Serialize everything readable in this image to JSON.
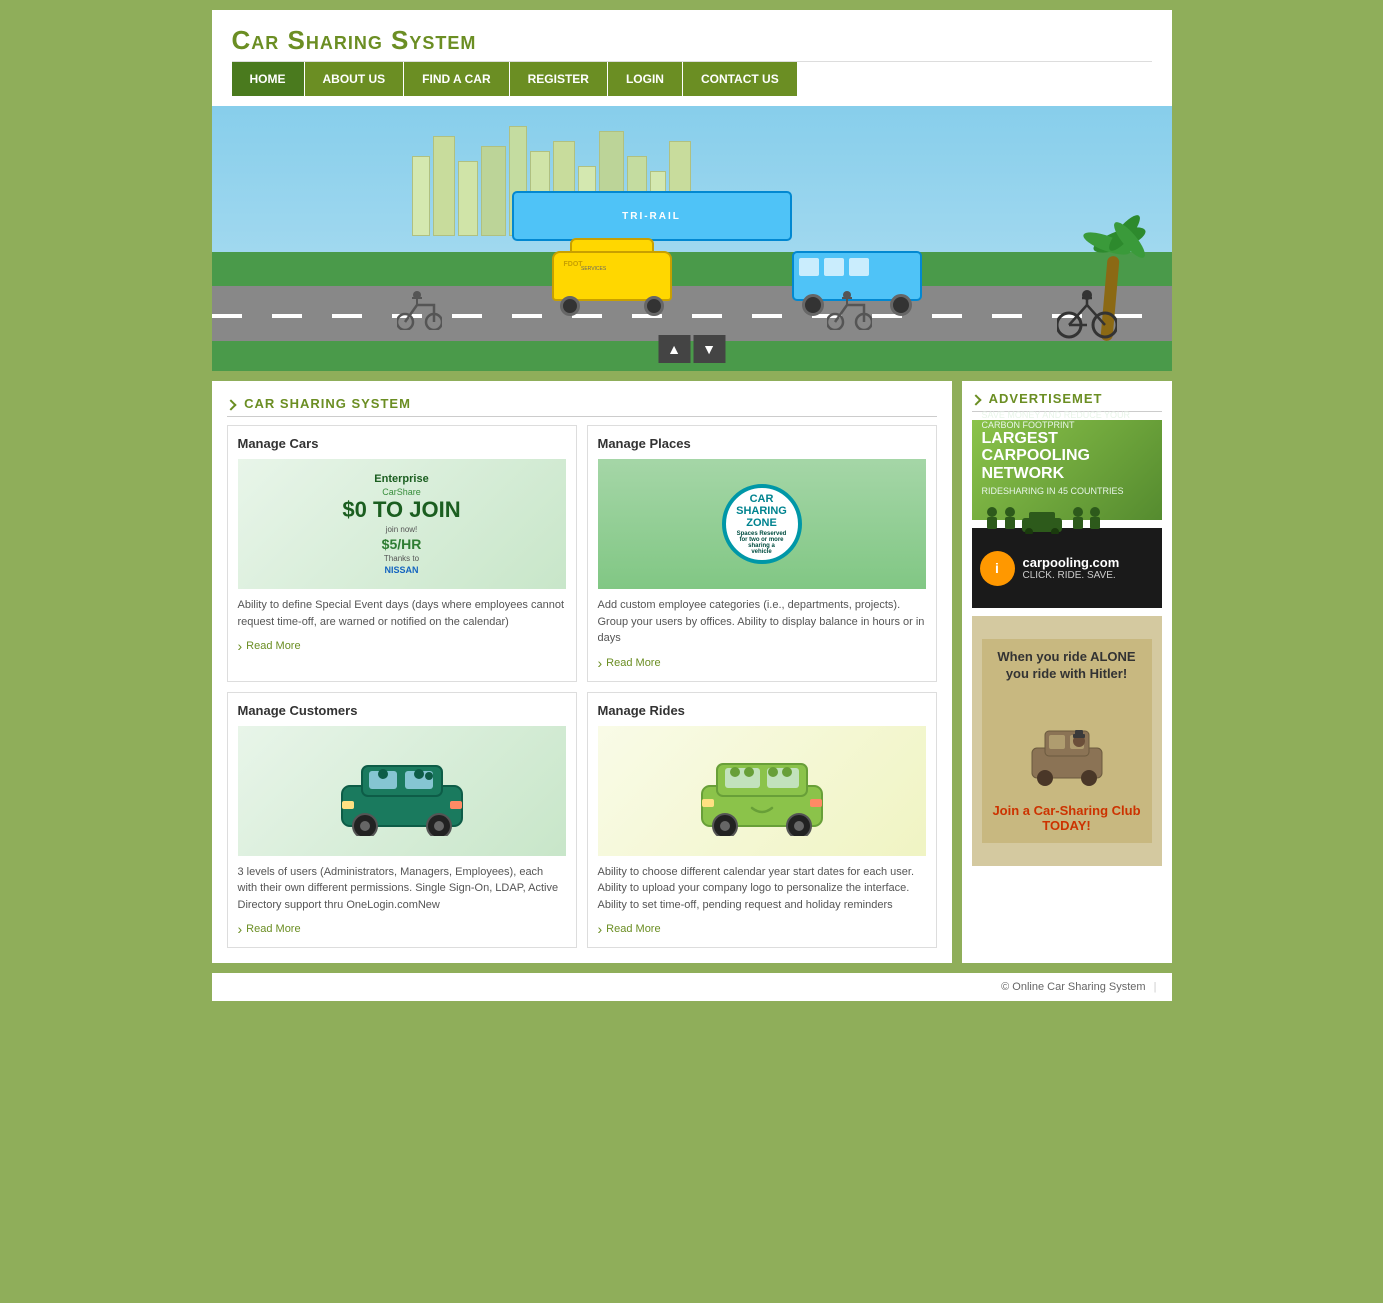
{
  "site": {
    "title": "Car Sharing System",
    "footer": "© Online Car Sharing System",
    "footer_divider": "|"
  },
  "nav": {
    "items": [
      {
        "id": "home",
        "label": "HOME",
        "active": true
      },
      {
        "id": "about",
        "label": "ABOUT US",
        "active": false
      },
      {
        "id": "find",
        "label": "FIND A CAR",
        "active": false
      },
      {
        "id": "register",
        "label": "REGISTER",
        "active": false
      },
      {
        "id": "login",
        "label": "LOGIN",
        "active": false
      },
      {
        "id": "contact",
        "label": "CONTACT US",
        "active": false
      }
    ]
  },
  "banner": {
    "up_label": "▲",
    "down_label": "▼"
  },
  "main_section": {
    "title": "CAR SHARING SYSTEM",
    "cards": [
      {
        "id": "manage-cars",
        "title": "Manage Cars",
        "image_alt": "Enterprise CarShare - $0 to Join, $5/HR Rates",
        "text": "Ability to define Special Event days (days where employees cannot request time-off, are warned or notified on the calendar)",
        "read_more": "Read More"
      },
      {
        "id": "manage-places",
        "title": "Manage Places",
        "image_alt": "Car Sharing Zone sign",
        "text": "Add custom employee categories (i.e., departments, projects). Group your users by offices. Ability to display balance in hours or in days",
        "read_more": "Read More"
      },
      {
        "id": "manage-customers",
        "title": "Manage Customers",
        "image_alt": "Car with people icon",
        "text": "3 levels of users (Administrators, Managers, Employees), each with their own different permissions. Single Sign-On, LDAP, Active Directory support thru OneLogin.comNew",
        "read_more": "Read More"
      },
      {
        "id": "manage-rides",
        "title": "Manage Rides",
        "image_alt": "Car with passengers icon",
        "text": "Ability to choose different calendar year start dates for each user. Ability to upload your company logo to personalize the interface. Ability to set time-off, pending request and holiday reminders",
        "read_more": "Read More"
      }
    ]
  },
  "sidebar": {
    "title": "ADVERTISEMET",
    "ads": [
      {
        "id": "carpooling-network",
        "headline": "LARGEST\nCARPOOLING\nNETWORK",
        "subtext": "SAVE MONEY AND REDUCE YOUR CARBON FOOTPRINT",
        "detail": "RIDESHARING IN 45 COUNTRIES"
      },
      {
        "id": "carpooling-com",
        "logo": "i",
        "name": "carpooling.com",
        "tagline": "CLICK. RIDE. SAVE."
      },
      {
        "id": "hitler-ad",
        "headline": "When you ride ALONE you ride with Hitler!",
        "subtext": "Join a Car-Sharing Club TODAY!"
      }
    ]
  }
}
